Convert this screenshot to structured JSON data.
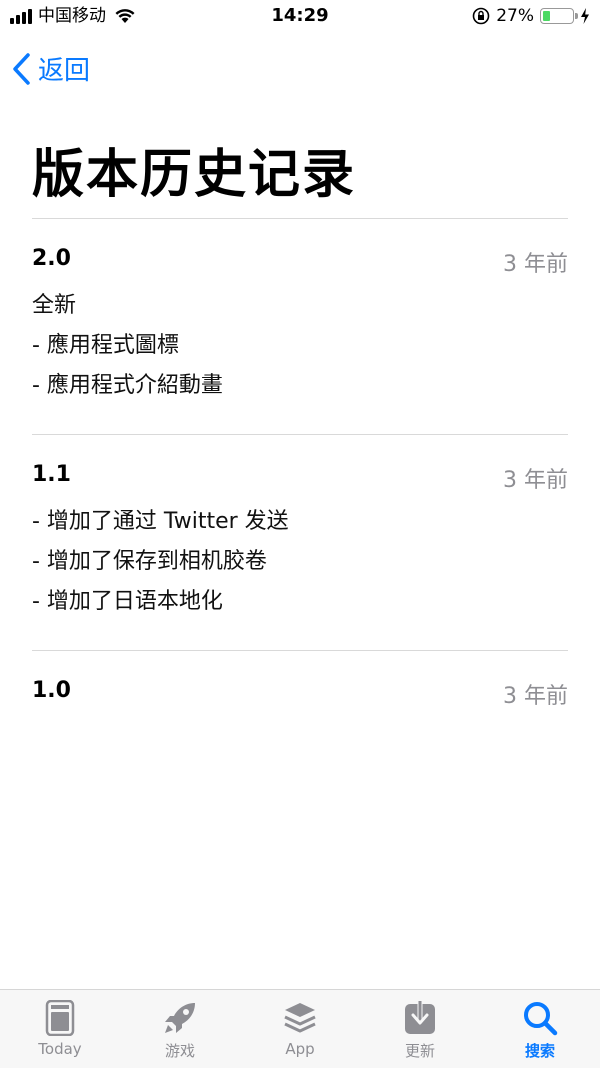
{
  "status": {
    "carrier": "中国移动",
    "time": "14:29",
    "battery_percent": "27%",
    "battery_level": 0.27,
    "battery_color": "#4cd964"
  },
  "nav": {
    "back_label": "返回",
    "accent_color": "#0a7aff"
  },
  "page": {
    "title": "版本历史记录"
  },
  "versions": [
    {
      "version": "2.0",
      "date": "3 年前",
      "notes": [
        "全新",
        "- 應用程式圖標",
        "- 應用程式介紹動畫"
      ]
    },
    {
      "version": "1.1",
      "date": "3 年前",
      "notes": [
        "- 增加了通过 Twitter 发送",
        "- 增加了保存到相机胶卷",
        "- 增加了日语本地化"
      ]
    },
    {
      "version": "1.0",
      "date": "3 年前",
      "notes": []
    }
  ],
  "tab_bar": {
    "tabs": [
      {
        "label": "Today",
        "icon": "today-icon",
        "active": false
      },
      {
        "label": "游戏",
        "icon": "rocket-icon",
        "active": false
      },
      {
        "label": "App",
        "icon": "app-stack-icon",
        "active": false
      },
      {
        "label": "更新",
        "icon": "updates-icon",
        "active": false
      },
      {
        "label": "搜索",
        "icon": "search-icon",
        "active": true
      }
    ]
  }
}
